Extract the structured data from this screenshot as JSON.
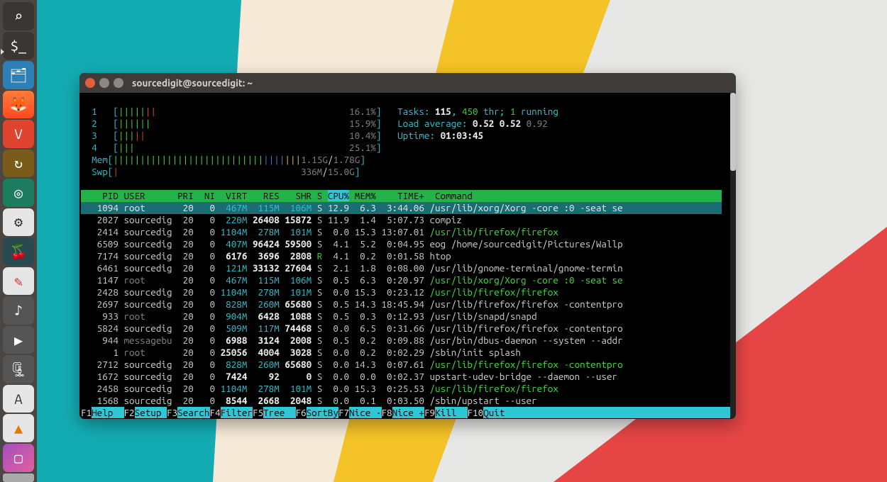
{
  "window": {
    "title": "sourcedigit@sourcedigit: ~"
  },
  "meters": {
    "cpu": [
      {
        "id": "1",
        "pct": "16.1%"
      },
      {
        "id": "2",
        "pct": "15.9%"
      },
      {
        "id": "3",
        "pct": "10.4%"
      },
      {
        "id": "4",
        "pct": "25.1%"
      }
    ],
    "mem": {
      "label": "Mem",
      "used": "1.15G",
      "total": "1.78G"
    },
    "swp": {
      "label": "Swp",
      "used": "336M",
      "total": "15.0G"
    }
  },
  "stats": {
    "tasks_label": "Tasks:",
    "tasks": "115",
    "threads": "450",
    "threads_suffix": "thr;",
    "running": "1",
    "running_suffix": "running",
    "load_label": "Load average:",
    "load1": "0.52",
    "load5": "0.52",
    "load15": "0.92",
    "uptime_label": "Uptime:",
    "uptime": "01:03:45"
  },
  "columns": {
    "PID": "PID",
    "USER": "USER",
    "PRI": "PRI",
    "NI": "NI",
    "VIRT": "VIRT",
    "RES": "RES",
    "SHR": "SHR",
    "S": "S",
    "CPU": "CPU%",
    "MEM": "MEM%",
    "TIME": "TIME+",
    "CMD": "Command"
  },
  "rows": [
    {
      "pid": "1094",
      "user": "root",
      "pri": "20",
      "ni": "0",
      "virt": "467M",
      "res": "115M",
      "shr": "106M",
      "s": "S",
      "cpu": "12.9",
      "mem": "6.3",
      "time": "3:44.06",
      "cmd": "/usr/lib/xorg/Xorg -core :0 -seat se",
      "sel": true
    },
    {
      "pid": "2027",
      "user": "sourcedig",
      "pri": "20",
      "ni": "0",
      "virt": "220M",
      "res": "26408",
      "shr": "15872",
      "s": "S",
      "cpu": "11.9",
      "mem": "1.4",
      "time": "5:07.73",
      "cmd": "compiz"
    },
    {
      "pid": "2414",
      "user": "sourcedig",
      "pri": "20",
      "ni": "0",
      "virt": "1104M",
      "res": "278M",
      "shr": "101M",
      "s": "S",
      "cpu": "0.0",
      "mem": "15.3",
      "time": "13:07.01",
      "cmd": "/usr/lib/firefox/firefox",
      "cmdcls": "gr"
    },
    {
      "pid": "6509",
      "user": "sourcedig",
      "pri": "20",
      "ni": "0",
      "virt": "407M",
      "res": "96424",
      "shr": "59500",
      "s": "S",
      "cpu": "4.1",
      "mem": "5.2",
      "time": "0:04.95",
      "cmd": "eog /home/sourcedigit/Pictures/Wallp"
    },
    {
      "pid": "7174",
      "user": "sourcedig",
      "pri": "20",
      "ni": "0",
      "virt": "6176",
      "res": "3696",
      "shr": "2808",
      "s": "R",
      "cpu": "4.1",
      "mem": "0.2",
      "time": "0:01.58",
      "cmd": "htop",
      "scls": "gr"
    },
    {
      "pid": "6461",
      "user": "sourcedig",
      "pri": "20",
      "ni": "0",
      "virt": "121M",
      "res": "33132",
      "shr": "27604",
      "s": "S",
      "cpu": "2.1",
      "mem": "1.8",
      "time": "0:08.00",
      "cmd": "/usr/lib/gnome-terminal/gnome-termin"
    },
    {
      "pid": "1147",
      "user": "root",
      "ucls": "gy",
      "pri": "20",
      "ni": "0",
      "virt": "467M",
      "res": "115M",
      "shr": "106M",
      "s": "S",
      "cpu": "0.5",
      "mem": "6.3",
      "time": "0:20.97",
      "cmd": "/usr/lib/xorg/Xorg -core :0 -seat se",
      "cmdcls": "gr"
    },
    {
      "pid": "2428",
      "user": "sourcedig",
      "pri": "20",
      "ni": "0",
      "virt": "1104M",
      "res": "278M",
      "shr": "101M",
      "s": "S",
      "cpu": "0.0",
      "mem": "15.3",
      "time": "0:23.12",
      "cmd": "/usr/lib/firefox/firefox",
      "cmdcls": "gr"
    },
    {
      "pid": "2697",
      "user": "sourcedig",
      "pri": "20",
      "ni": "0",
      "virt": "828M",
      "res": "260M",
      "shr": "65680",
      "s": "S",
      "cpu": "0.5",
      "mem": "14.3",
      "time": "18:45.94",
      "cmd": "/usr/lib/firefox/firefox -contentpro"
    },
    {
      "pid": "933",
      "user": "root",
      "ucls": "gy",
      "pri": "20",
      "ni": "0",
      "virt": "904M",
      "res": "6428",
      "shr": "1088",
      "s": "S",
      "cpu": "0.5",
      "mem": "0.3",
      "time": "0:12.93",
      "cmd": "/usr/lib/snapd/snapd"
    },
    {
      "pid": "5824",
      "user": "sourcedig",
      "pri": "20",
      "ni": "0",
      "virt": "509M",
      "res": "117M",
      "shr": "74468",
      "s": "S",
      "cpu": "0.0",
      "mem": "6.5",
      "time": "0:31.66",
      "cmd": "/usr/lib/firefox/firefox -contentpro"
    },
    {
      "pid": "944",
      "user": "messagebu",
      "ucls": "gy",
      "pri": "20",
      "ni": "0",
      "virt": "6988",
      "res": "3124",
      "shr": "2008",
      "s": "S",
      "cpu": "0.5",
      "mem": "0.2",
      "time": "0:09.88",
      "cmd": "/usr/bin/dbus-daemon --system --addr"
    },
    {
      "pid": "1",
      "user": "root",
      "ucls": "gy",
      "pri": "20",
      "ni": "0",
      "virt": "25056",
      "res": "4004",
      "shr": "3028",
      "s": "S",
      "cpu": "0.0",
      "mem": "0.2",
      "time": "0:02.29",
      "cmd": "/sbin/init splash"
    },
    {
      "pid": "2712",
      "user": "sourcedig",
      "pri": "20",
      "ni": "0",
      "virt": "828M",
      "res": "260M",
      "shr": "65680",
      "s": "S",
      "cpu": "0.0",
      "mem": "14.3",
      "time": "0:07.61",
      "cmd": "/usr/lib/firefox/firefox -contentpro",
      "cmdcls": "gr"
    },
    {
      "pid": "1672",
      "user": "sourcedig",
      "pri": "20",
      "ni": "0",
      "virt": "7424",
      "res": "92",
      "shr": "0",
      "s": "S",
      "cpu": "0.0",
      "mem": "0.0",
      "time": "0:02.37",
      "cmd": "upstart-udev-bridge --daemon --user"
    },
    {
      "pid": "2458",
      "user": "sourcedig",
      "pri": "20",
      "ni": "0",
      "virt": "1104M",
      "res": "278M",
      "shr": "101M",
      "s": "S",
      "cpu": "0.0",
      "mem": "15.3",
      "time": "0:25.53",
      "cmd": "/usr/lib/firefox/firefox",
      "cmdcls": "gr"
    },
    {
      "pid": "1568",
      "user": "sourcedig",
      "pri": "20",
      "ni": "0",
      "virt": "8544",
      "res": "2668",
      "shr": "2048",
      "s": "S",
      "cpu": "0.0",
      "mem": "0.1",
      "time": "0:03.50",
      "cmd": "/sbin/upstart --user"
    }
  ],
  "fkeys": [
    {
      "k": "F1",
      "v": "Help  "
    },
    {
      "k": "F2",
      "v": "Setup "
    },
    {
      "k": "F3",
      "v": "Search"
    },
    {
      "k": "F4",
      "v": "Filter"
    },
    {
      "k": "F5",
      "v": "Tree  "
    },
    {
      "k": "F6",
      "v": "SortBy"
    },
    {
      "k": "F7",
      "v": "Nice -"
    },
    {
      "k": "F8",
      "v": "Nice +"
    },
    {
      "k": "F9",
      "v": "Kill  "
    },
    {
      "k": "F10",
      "v": "Quit  "
    }
  ],
  "launcher": [
    {
      "name": "search-icon",
      "cls": "li-dark",
      "glyph": "⌕"
    },
    {
      "name": "terminal-icon",
      "cls": "li-dark",
      "glyph": "$_"
    },
    {
      "name": "files-icon",
      "cls": "li-files",
      "glyph": "🗂"
    },
    {
      "name": "firefox-icon",
      "cls": "li-fire",
      "glyph": "🦊"
    },
    {
      "name": "vivaldi-icon",
      "cls": "li-viv",
      "glyph": "V"
    },
    {
      "name": "updater-icon",
      "cls": "li-updt",
      "glyph": "↻"
    },
    {
      "name": "shutter-icon",
      "cls": "li-shot",
      "glyph": "◎"
    },
    {
      "name": "settings-icon",
      "cls": "li-sett",
      "glyph": "⚙"
    },
    {
      "name": "cherrytree-icon",
      "cls": "li-che",
      "glyph": "🍒"
    },
    {
      "name": "draw-icon",
      "cls": "li-draw",
      "glyph": "✎"
    },
    {
      "name": "audio-icon",
      "cls": "li-gray",
      "glyph": "♪"
    },
    {
      "name": "media-icon",
      "cls": "li-gray",
      "glyph": "▶"
    },
    {
      "name": "archive-icon",
      "cls": "li-gray",
      "glyph": "🗜"
    },
    {
      "name": "software-icon",
      "cls": "li-soft",
      "glyph": "A"
    },
    {
      "name": "vlc-icon",
      "cls": "li-vlc",
      "glyph": "▲"
    },
    {
      "name": "displays-icon",
      "cls": "li-disp",
      "glyph": "▢"
    }
  ]
}
